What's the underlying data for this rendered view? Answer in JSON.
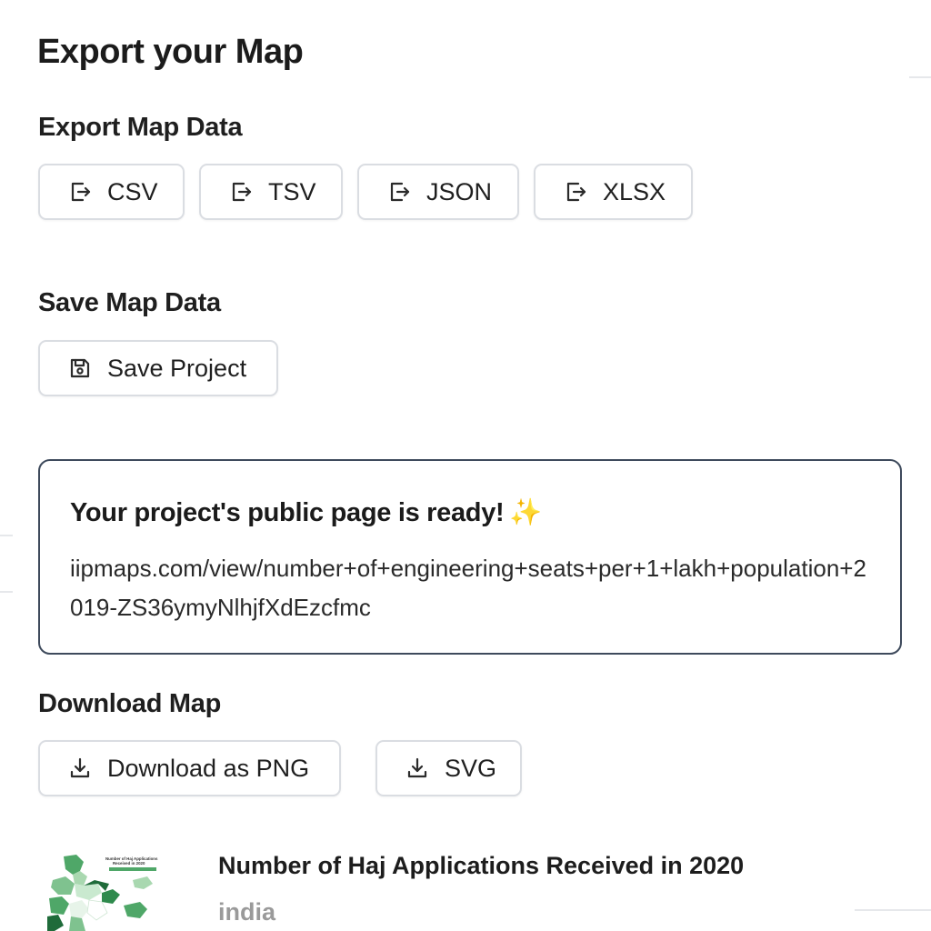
{
  "page": {
    "title": "Export your Map"
  },
  "export_data": {
    "heading": "Export Map Data",
    "buttons": [
      {
        "label": "CSV",
        "icon": "export-icon"
      },
      {
        "label": "TSV",
        "icon": "export-icon"
      },
      {
        "label": "JSON",
        "icon": "export-icon"
      },
      {
        "label": "XLSX",
        "icon": "export-icon"
      }
    ]
  },
  "save_data": {
    "heading": "Save Map Data",
    "button": {
      "label": "Save Project",
      "icon": "floppy-disk-icon"
    }
  },
  "public_page": {
    "title": "Your project's public page is ready!",
    "emoji": "✨",
    "url": "iipmaps.com/view/number+of+engineering+seats+per+1+lakh+population+2019-ZS36ymyNlhjfXdEzcfmc"
  },
  "download": {
    "heading": "Download Map",
    "buttons": [
      {
        "label": "Download as PNG",
        "icon": "download-icon"
      },
      {
        "label": "SVG",
        "icon": "download-icon"
      }
    ]
  },
  "project_card": {
    "title": "Number of Haj Applications Received in 2020",
    "region": "india",
    "thumbnail_title": "Number of Haj Applications Received in 2020"
  },
  "colors": {
    "button_border": "#dadde2",
    "card_border": "#3e4a5c",
    "text": "#1f1f1f",
    "muted": "#9a9a9a",
    "map_green_dark": "#1f6b3a",
    "map_green_mid": "#4fa768",
    "map_green_light": "#a9d8b0"
  }
}
